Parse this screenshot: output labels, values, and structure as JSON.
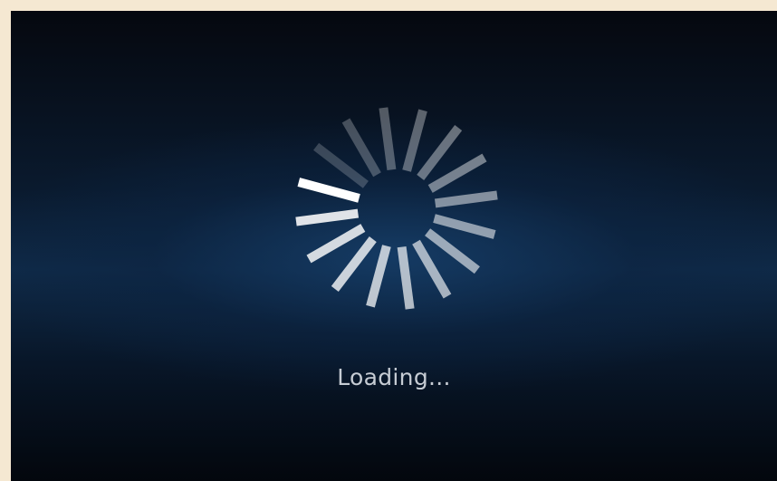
{
  "screen": {
    "status_text": "Loading...",
    "background_color": "#0a1a2e",
    "accent_glow_color": "#163e69"
  },
  "spinner": {
    "icon": "loading-spinner-icon",
    "segment_count": 16,
    "segment_color": "#ffffff"
  }
}
